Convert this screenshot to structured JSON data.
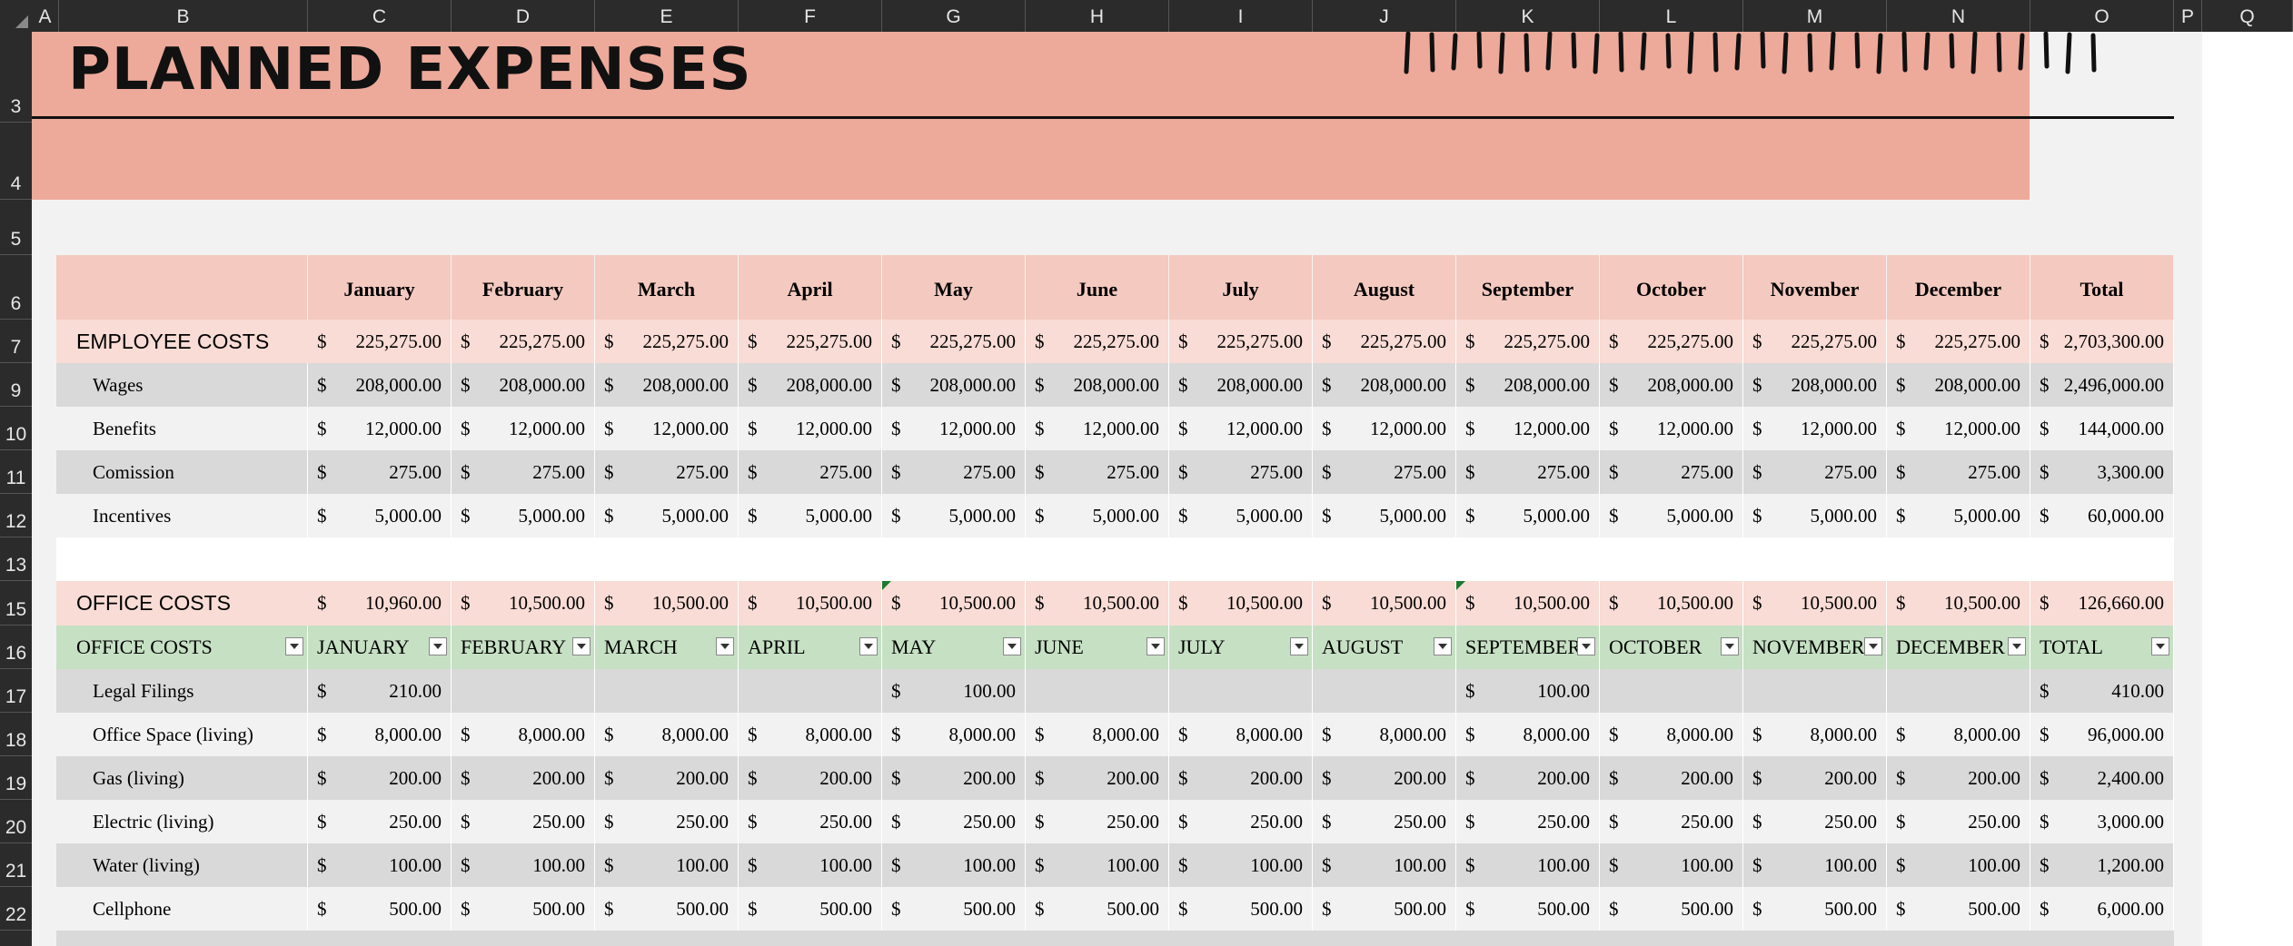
{
  "columns": [
    "A",
    "B",
    "C",
    "D",
    "E",
    "F",
    "G",
    "H",
    "I",
    "J",
    "K",
    "L",
    "M",
    "N",
    "O",
    "P",
    "Q"
  ],
  "rows": [
    "3",
    "4",
    "5",
    "6",
    "7",
    "9",
    "10",
    "11",
    "12",
    "13",
    "15",
    "16",
    "17",
    "18",
    "19",
    "20",
    "21",
    "22"
  ],
  "title": "PLANNED EXPENSES",
  "months": [
    "January",
    "February",
    "March",
    "April",
    "May",
    "June",
    "July",
    "August",
    "September",
    "October",
    "November",
    "December",
    "Total"
  ],
  "employee": {
    "label": "EMPLOYEE COSTS",
    "totals": [
      "225,275.00",
      "225,275.00",
      "225,275.00",
      "225,275.00",
      "225,275.00",
      "225,275.00",
      "225,275.00",
      "225,275.00",
      "225,275.00",
      "225,275.00",
      "225,275.00",
      "225,275.00",
      "2,703,300.00"
    ],
    "items": [
      {
        "label": "Wages",
        "values": [
          "208,000.00",
          "208,000.00",
          "208,000.00",
          "208,000.00",
          "208,000.00",
          "208,000.00",
          "208,000.00",
          "208,000.00",
          "208,000.00",
          "208,000.00",
          "208,000.00",
          "208,000.00",
          "2,496,000.00"
        ]
      },
      {
        "label": "Benefits",
        "values": [
          "12,000.00",
          "12,000.00",
          "12,000.00",
          "12,000.00",
          "12,000.00",
          "12,000.00",
          "12,000.00",
          "12,000.00",
          "12,000.00",
          "12,000.00",
          "12,000.00",
          "12,000.00",
          "144,000.00"
        ]
      },
      {
        "label": "Comission",
        "values": [
          "275.00",
          "275.00",
          "275.00",
          "275.00",
          "275.00",
          "275.00",
          "275.00",
          "275.00",
          "275.00",
          "275.00",
          "275.00",
          "275.00",
          "3,300.00"
        ]
      },
      {
        "label": "Incentives",
        "values": [
          "5,000.00",
          "5,000.00",
          "5,000.00",
          "5,000.00",
          "5,000.00",
          "5,000.00",
          "5,000.00",
          "5,000.00",
          "5,000.00",
          "5,000.00",
          "5,000.00",
          "5,000.00",
          "60,000.00"
        ]
      }
    ]
  },
  "office": {
    "label": "OFFICE COSTS",
    "totals": [
      "10,960.00",
      "10,500.00",
      "10,500.00",
      "10,500.00",
      "10,500.00",
      "10,500.00",
      "10,500.00",
      "10,500.00",
      "10,500.00",
      "10,500.00",
      "10,500.00",
      "10,500.00",
      "126,660.00"
    ],
    "table_headers": [
      "OFFICE COSTS",
      "JANUARY",
      "FEBRUARY",
      "MARCH",
      "APRIL",
      "MAY",
      "JUNE",
      "JULY",
      "AUGUST",
      "SEPTEMBER",
      "OCTOBER",
      "NOVEMBER",
      "DECEMBER",
      "TOTAL"
    ],
    "items": [
      {
        "label": "Legal Filings",
        "values": [
          "210.00",
          "",
          "",
          "",
          "100.00",
          "",
          "",
          "",
          "100.00",
          "",
          "",
          "",
          "410.00"
        ]
      },
      {
        "label": "Office Space (living)",
        "values": [
          "8,000.00",
          "8,000.00",
          "8,000.00",
          "8,000.00",
          "8,000.00",
          "8,000.00",
          "8,000.00",
          "8,000.00",
          "8,000.00",
          "8,000.00",
          "8,000.00",
          "8,000.00",
          "96,000.00"
        ]
      },
      {
        "label": "Gas (living)",
        "values": [
          "200.00",
          "200.00",
          "200.00",
          "200.00",
          "200.00",
          "200.00",
          "200.00",
          "200.00",
          "200.00",
          "200.00",
          "200.00",
          "200.00",
          "2,400.00"
        ]
      },
      {
        "label": "Electric (living)",
        "values": [
          "250.00",
          "250.00",
          "250.00",
          "250.00",
          "250.00",
          "250.00",
          "250.00",
          "250.00",
          "250.00",
          "250.00",
          "250.00",
          "250.00",
          "3,000.00"
        ]
      },
      {
        "label": "Water (living)",
        "values": [
          "100.00",
          "100.00",
          "100.00",
          "100.00",
          "100.00",
          "100.00",
          "100.00",
          "100.00",
          "100.00",
          "100.00",
          "100.00",
          "100.00",
          "1,200.00"
        ]
      },
      {
        "label": "Cellphone",
        "values": [
          "500.00",
          "500.00",
          "500.00",
          "500.00",
          "500.00",
          "500.00",
          "500.00",
          "500.00",
          "500.00",
          "500.00",
          "500.00",
          "500.00",
          "6,000.00"
        ]
      }
    ]
  },
  "currency_symbol": "$"
}
